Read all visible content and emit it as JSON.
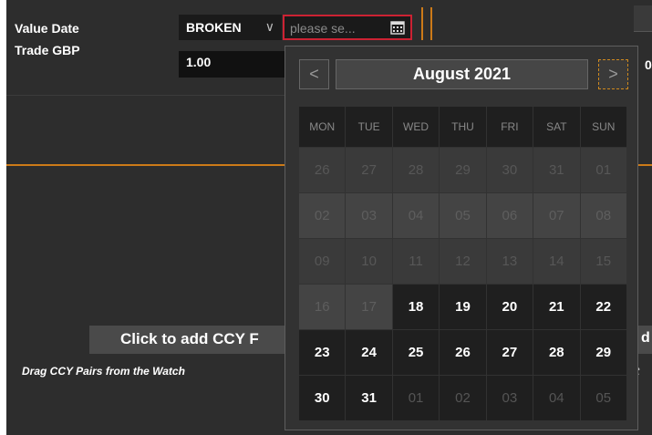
{
  "deal": {
    "value_date_label": "Value Date",
    "tenor_value": "BROKEN",
    "tenor_chevron": "∨",
    "date_placeholder": "please se...",
    "trade_label": "Trade GBP",
    "trade_amount": "1.00"
  },
  "panel": {
    "add_ccy_label": "Click to add CCY F",
    "drag_hint": "Drag CCY Pairs from the Watch",
    "right_zero": "0",
    "right_btn_stub": "d",
    "right_hint_stub": "t"
  },
  "calendar": {
    "title": "August 2021",
    "prev_label": "<",
    "next_label": ">",
    "days_of_week": [
      "MON",
      "TUE",
      "WED",
      "THU",
      "FRI",
      "SAT",
      "SUN"
    ],
    "weeks": [
      [
        {
          "d": "26",
          "s": "off"
        },
        {
          "d": "27",
          "s": "off"
        },
        {
          "d": "28",
          "s": "off"
        },
        {
          "d": "29",
          "s": "off"
        },
        {
          "d": "30",
          "s": "off"
        },
        {
          "d": "31",
          "s": "off"
        },
        {
          "d": "01",
          "s": "off"
        }
      ],
      [
        {
          "d": "02",
          "s": "dis"
        },
        {
          "d": "03",
          "s": "dis"
        },
        {
          "d": "04",
          "s": "dis"
        },
        {
          "d": "05",
          "s": "dis"
        },
        {
          "d": "06",
          "s": "dis"
        },
        {
          "d": "07",
          "s": "dis"
        },
        {
          "d": "08",
          "s": "dis"
        }
      ],
      [
        {
          "d": "09",
          "s": "off"
        },
        {
          "d": "10",
          "s": "off"
        },
        {
          "d": "11",
          "s": "off"
        },
        {
          "d": "12",
          "s": "off"
        },
        {
          "d": "13",
          "s": "off"
        },
        {
          "d": "14",
          "s": "off"
        },
        {
          "d": "15",
          "s": "off"
        }
      ],
      [
        {
          "d": "16",
          "s": "dis"
        },
        {
          "d": "17",
          "s": "dis"
        },
        {
          "d": "18",
          "s": "on"
        },
        {
          "d": "19",
          "s": "on"
        },
        {
          "d": "20",
          "s": "on"
        },
        {
          "d": "21",
          "s": "on"
        },
        {
          "d": "22",
          "s": "on"
        }
      ],
      [
        {
          "d": "23",
          "s": "on"
        },
        {
          "d": "24",
          "s": "on"
        },
        {
          "d": "25",
          "s": "on"
        },
        {
          "d": "26",
          "s": "on"
        },
        {
          "d": "27",
          "s": "on"
        },
        {
          "d": "28",
          "s": "on"
        },
        {
          "d": "29",
          "s": "on"
        }
      ],
      [
        {
          "d": "30",
          "s": "on"
        },
        {
          "d": "31",
          "s": "on"
        },
        {
          "d": "01",
          "s": "off2"
        },
        {
          "d": "02",
          "s": "off2"
        },
        {
          "d": "03",
          "s": "off2"
        },
        {
          "d": "04",
          "s": "off2"
        },
        {
          "d": "05",
          "s": "off2"
        }
      ]
    ]
  },
  "colors": {
    "accent_orange": "#cc7a18",
    "focus_red": "#cc2233",
    "background": "#2d2d2d"
  },
  "icons": {
    "date_picker": "calendar-icon",
    "tenor_dropdown": "chevron-down-icon"
  }
}
